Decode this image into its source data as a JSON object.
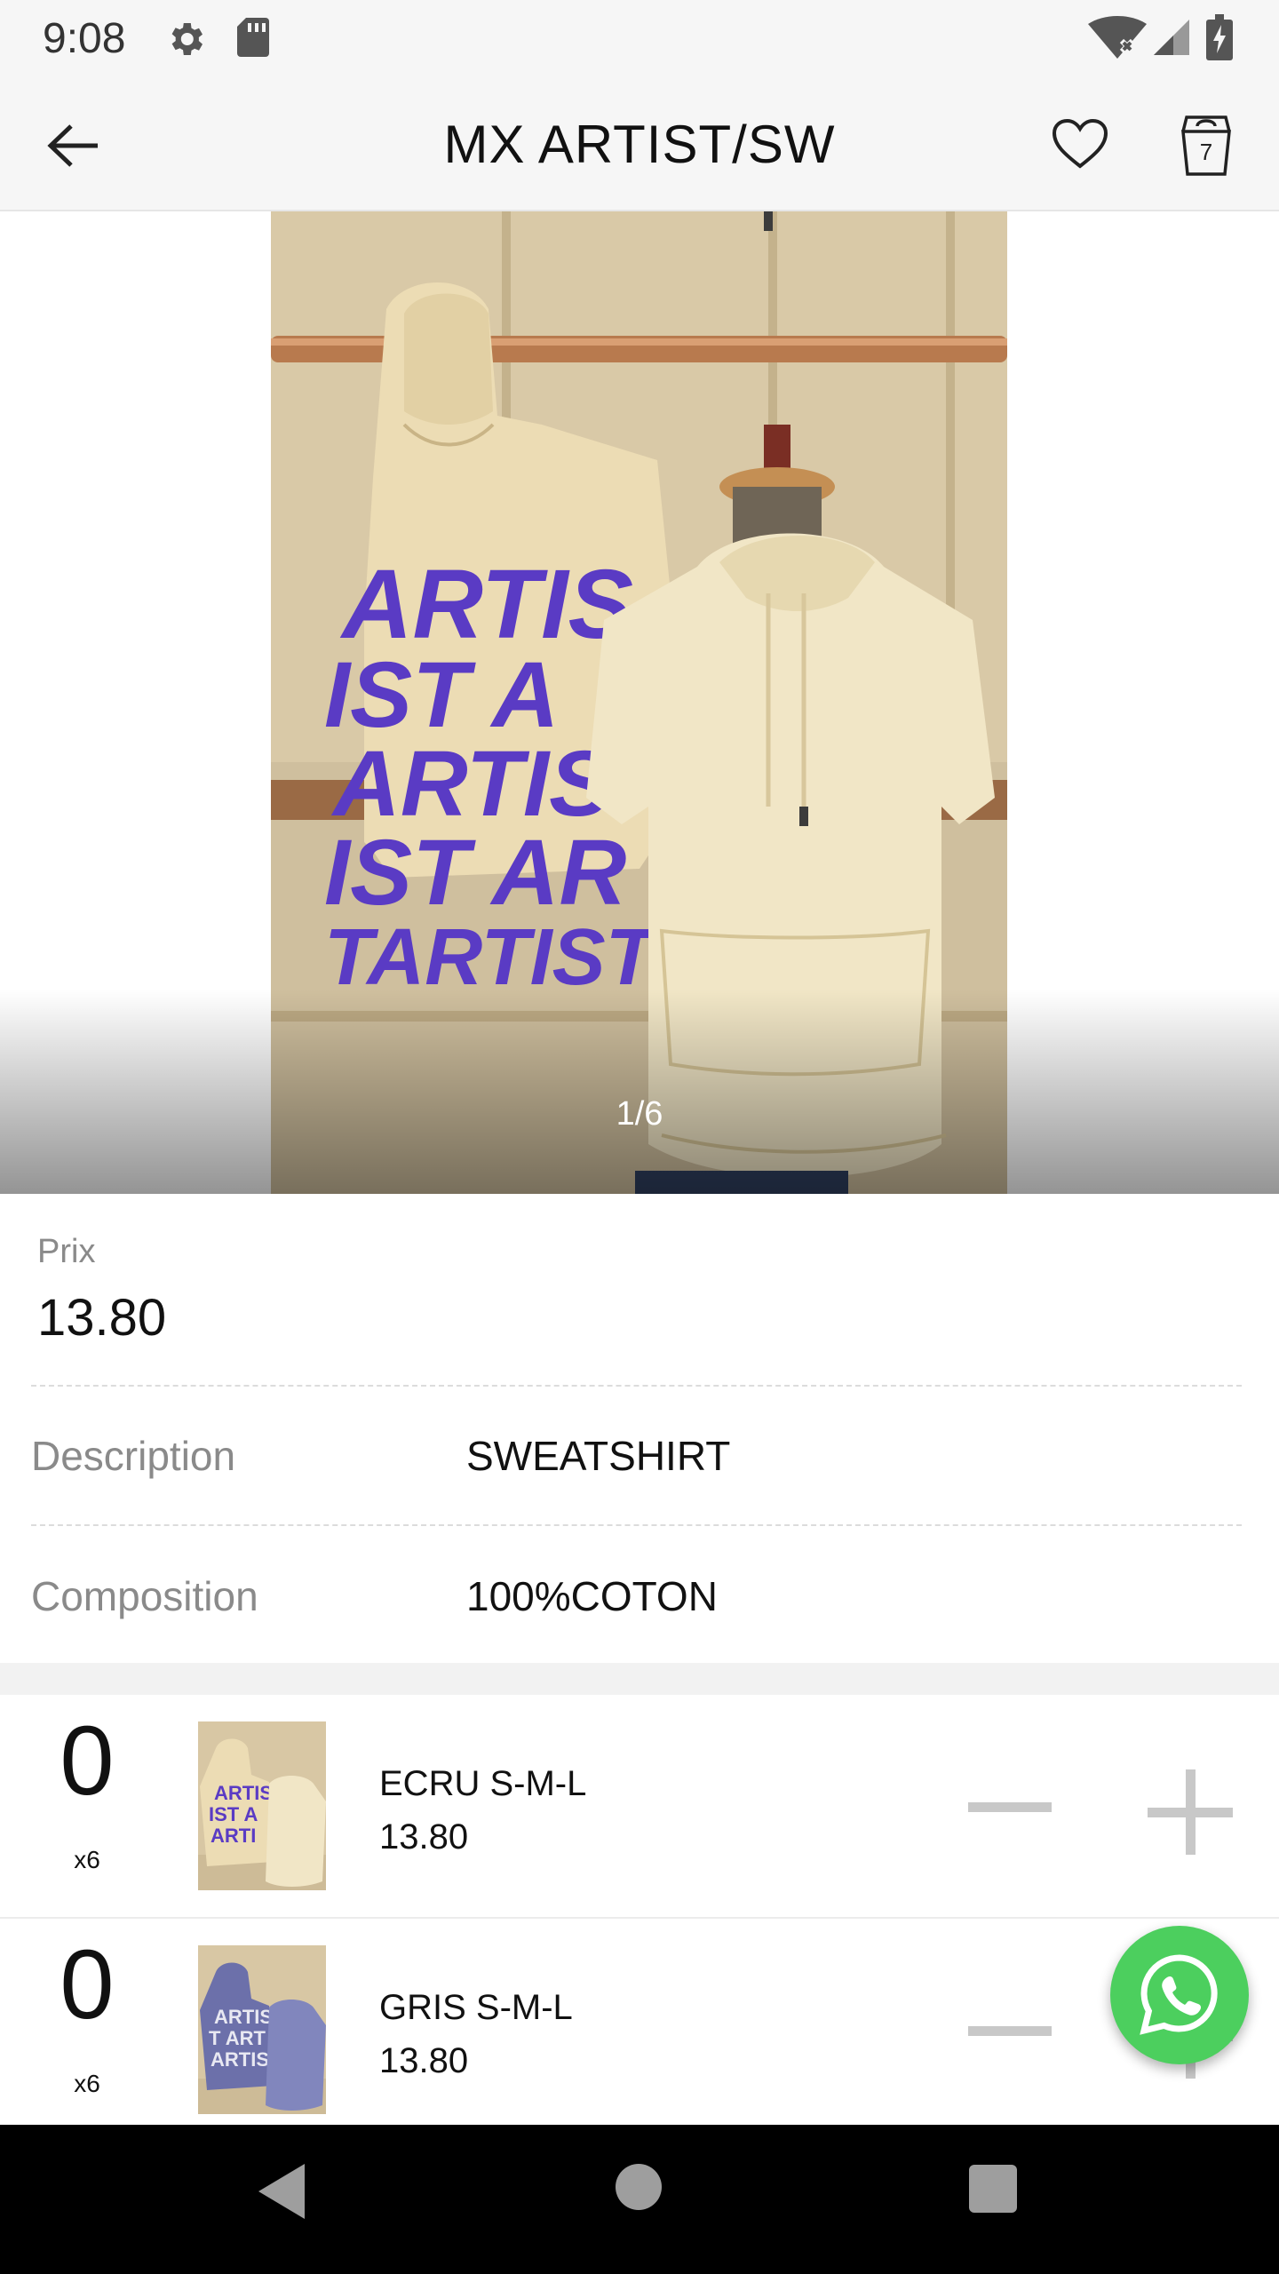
{
  "status_bar": {
    "time": "9:08",
    "icons": [
      "gear-icon",
      "sd-card-icon",
      "wifi-icon",
      "signal-icon",
      "battery-charging-icon"
    ]
  },
  "toolbar": {
    "title": "MX ARTIST/SW",
    "back_icon": "arrow-left-icon",
    "favorite_icon": "heart-icon",
    "bag_icon": "shopping-bag-icon",
    "bag_count": "7"
  },
  "gallery": {
    "counter": "1/6",
    "current_index": 1,
    "total": 6
  },
  "product": {
    "price_label": "Prix",
    "price_value": "13.80",
    "description_label": "Description",
    "description_value": "SWEATSHIRT",
    "composition_label": "Composition",
    "composition_value": "100%COTON"
  },
  "variants": [
    {
      "quantity": "0",
      "pack": "x6",
      "name": "ECRU S-M-L",
      "price": "13.80",
      "color": "#efe2bf"
    },
    {
      "quantity": "0",
      "pack": "x6",
      "name": "GRIS S-M-L",
      "price": "13.80",
      "color": "#7d82b6"
    }
  ],
  "colors": {
    "accent_whatsapp": "#4ccf5e",
    "print_purple": "#5a3bc4",
    "hoodie_cream": "#efe2bf"
  }
}
